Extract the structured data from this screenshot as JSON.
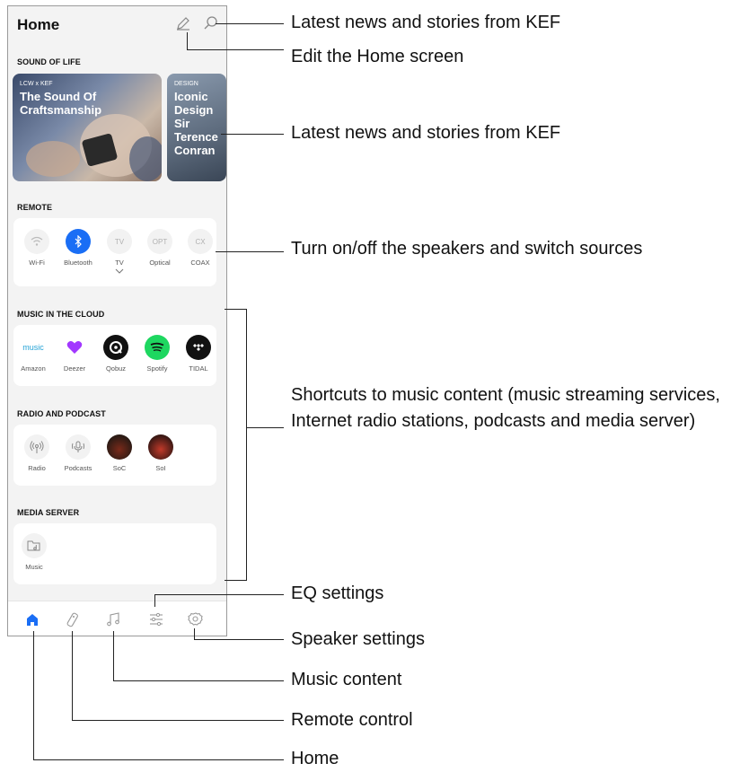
{
  "app": {
    "title": "Home",
    "sections": {
      "sound_of_life": "SOUND OF LIFE",
      "remote": "REMOTE",
      "music_cloud": "MUSIC IN THE CLOUD",
      "radio_podcast": "RADIO AND PODCAST",
      "media_server": "MEDIA SERVER"
    },
    "cards": [
      {
        "tag": "LCW x KEF",
        "title": "The Sound Of Craftsmanship"
      },
      {
        "tag": "DESIGN",
        "title": "Iconic Design Sir Terence Conran"
      }
    ],
    "remote": [
      {
        "label": "Wi-Fi",
        "glyph": ""
      },
      {
        "label": "Bluetooth",
        "glyph": ""
      },
      {
        "label": "TV",
        "glyph": "TV"
      },
      {
        "label": "Optical",
        "glyph": "OPT"
      },
      {
        "label": "COAX",
        "glyph": "CX"
      }
    ],
    "music_cloud": [
      {
        "label": "Amazon",
        "glyph": "music"
      },
      {
        "label": "Deezer",
        "glyph": ""
      },
      {
        "label": "Qobuz",
        "glyph": ""
      },
      {
        "label": "Spotify",
        "glyph": ""
      },
      {
        "label": "TIDAL",
        "glyph": ""
      }
    ],
    "radio_podcast": [
      {
        "label": "Radio",
        "glyph": ""
      },
      {
        "label": "Podcasts",
        "glyph": ""
      },
      {
        "label": "SoC",
        "glyph": ""
      },
      {
        "label": "SoI",
        "glyph": ""
      }
    ],
    "media_server": [
      {
        "label": "Music",
        "glyph": ""
      }
    ],
    "colors": {
      "accent": "#1a6ef5",
      "spotify": "#1ed760",
      "deezer": "#a238ff"
    }
  },
  "annotations": {
    "latest_news_top": "Latest news and stories from KEF",
    "edit_home": "Edit the Home screen",
    "latest_news_cards": "Latest news and stories from KEF",
    "remote": "Turn on/off the speakers and switch sources",
    "shortcuts": "Shortcuts to music content (music streaming services, Internet radio stations, podcasts and media server)",
    "eq": "EQ settings",
    "speaker": "Speaker settings",
    "music_content": "Music content",
    "remote_control": "Remote control",
    "home": "Home"
  }
}
